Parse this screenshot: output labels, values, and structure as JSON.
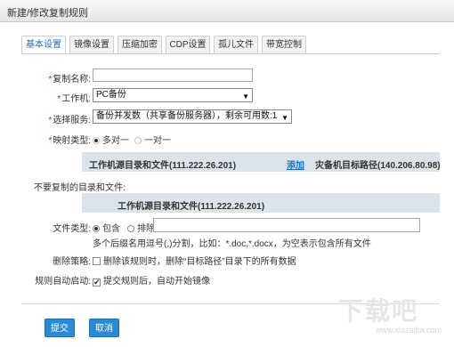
{
  "window": {
    "title": "新建/修改复制规则"
  },
  "tabs": [
    "基本设置",
    "镜像设置",
    "压缩加密",
    "CDP设置",
    "孤儿文件",
    "带宽控制"
  ],
  "form": {
    "name_label": "复制名称:",
    "name_value": "",
    "machine_label": "工作机:",
    "machine_value": "PC备份",
    "service_label": "选择服务:",
    "service_value": "备份并发数（共享备份服务器），剩余可用数:1",
    "mapping_label": "映射类型:",
    "mapping_opt1": "多对一",
    "mapping_opt2": "一对一"
  },
  "dir_table": {
    "source_header": "工作机源目录和文件(111.222.26.201)",
    "add_link": "添加",
    "target_header": "灾备机目标路径(140.206.80.98)"
  },
  "exclude": {
    "label": "不要复制的目录和文件:",
    "header": "工作机源目录和文件(111.222.26.201)"
  },
  "filetype": {
    "label": "文件类型:",
    "include": "包含",
    "exclude": "排除",
    "value": "",
    "hint": "多个后缀名用逗号(,)分割，比如：*.doc,*.docx，为空表示包含所有文件"
  },
  "delete_policy": {
    "label": "删除策略:",
    "text": "删除该规则时，删除“目标路径”目录下的所有数据"
  },
  "auto_start": {
    "label": "规则自动启动:",
    "text": "提交规则后，自动开始镜像"
  },
  "buttons": {
    "submit": "提交",
    "cancel": "取消"
  },
  "watermark": {
    "text": "下载吧",
    "sub": "www.xiazaiba.com"
  },
  "colors": {
    "accent": "#2b8ad6",
    "link": "#1a6fc2",
    "bar": "#dde3ea",
    "required": "#e02020"
  }
}
